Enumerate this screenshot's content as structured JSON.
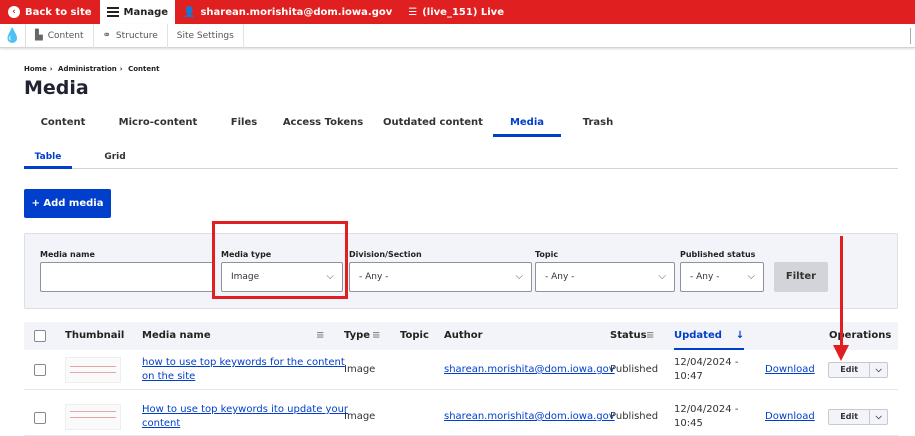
{
  "toolbar": {
    "back": "Back to site",
    "manage": "Manage",
    "user": "sharean.morishita@dom.iowa.gov",
    "env": "(live_151) Live"
  },
  "subnav": {
    "content": "Content",
    "structure": "Structure",
    "settings": "Site Settings"
  },
  "breadcrumb": [
    "Home",
    "Administration",
    "Content"
  ],
  "page_title": "Media",
  "primary_tabs": [
    "Content",
    "Micro-content",
    "Files",
    "Access Tokens",
    "Outdated content",
    "Media",
    "Trash"
  ],
  "secondary_tabs": [
    "Table",
    "Grid"
  ],
  "add_media": "+ Add media",
  "filters": {
    "media_name_label": "Media name",
    "media_type_label": "Media type",
    "media_type_value": "Image",
    "division_label": "Division/Section",
    "division_value": "- Any -",
    "topic_label": "Topic",
    "topic_value": "- Any -",
    "published_label": "Published status",
    "published_value": "- Any -",
    "filter_button": "Filter"
  },
  "table": {
    "headers": {
      "thumbnail": "Thumbnail",
      "media_name": "Media name",
      "type": "Type",
      "topic": "Topic",
      "author": "Author",
      "status": "Status",
      "updated": "Updated",
      "operations": "Operations"
    },
    "rows": [
      {
        "name_line1": "how to use top keywords for the content",
        "name_line2": "on the site",
        "type": "Image",
        "author": "sharean.morishita@dom.iowa.gov",
        "status": "Published",
        "updated_line1": "12/04/2024 -",
        "updated_line2": "10:47",
        "download": "Download",
        "edit": "Edit"
      },
      {
        "name_line1": "How to use top keywords ito update your",
        "name_line2": "content",
        "type": "Image",
        "author": "sharean.morishita@dom.iowa.gov",
        "status": "Published",
        "updated_line1": "12/04/2024 -",
        "updated_line2": "10:45",
        "download": "Download",
        "edit": "Edit"
      }
    ]
  },
  "colors": {
    "accent": "#003ecc",
    "toolbar": "#e02020",
    "annotation": "#e02020"
  }
}
